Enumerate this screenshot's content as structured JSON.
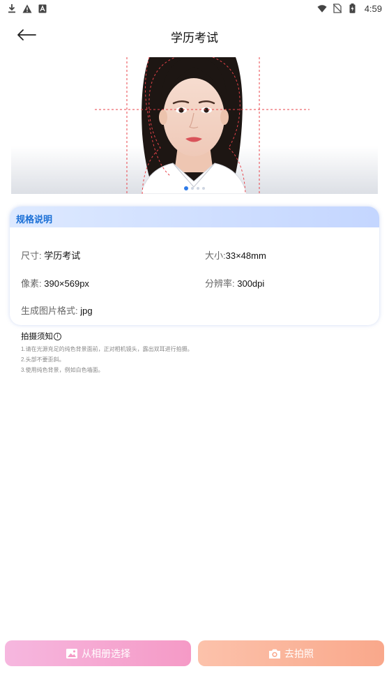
{
  "status_bar": {
    "time": "4:59",
    "left_icons": [
      "download-icon",
      "warning-icon",
      "sim-alert-icon"
    ],
    "right_icons": [
      "wifi-icon",
      "no-sim-icon",
      "battery-charging-icon"
    ]
  },
  "header": {
    "title": "学历考试",
    "back_icon": "arrow-left-icon"
  },
  "banner": {
    "page_count": 4,
    "active_page": 1
  },
  "spec": {
    "title": "规格说明",
    "size_label": "尺寸: ",
    "size_value": "学历考试",
    "dimension_label": "大小:",
    "dimension_value": "33×48mm",
    "pixels_label": "像素: ",
    "pixels_value": "390×569px",
    "resolution_label": "分辨率: ",
    "resolution_value": "300dpi",
    "format_label": "生成图片格式: ",
    "format_value": "jpg"
  },
  "notice": {
    "title": "拍摄须知",
    "info_symbol": "i",
    "lines": [
      "1.请在光源充足的纯色背景面前，正对相机镜头，露出双耳进行拍摄。",
      "2.头部不要歪斜。",
      "3.使用纯色背景，例如白色墙面。"
    ]
  },
  "buttons": {
    "album_label": "从相册选择",
    "camera_label": "去拍照"
  },
  "colors": {
    "accent_blue": "#1a6fd6",
    "album_gradient": [
      "#f6b7df",
      "#f59ac6"
    ],
    "camera_gradient": [
      "#fcc2ab",
      "#f9a88b"
    ],
    "guide_line": "#e8434a"
  }
}
